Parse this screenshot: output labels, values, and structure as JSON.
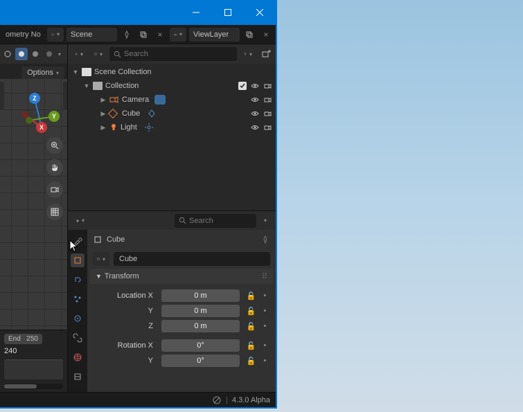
{
  "window": {
    "minimize": "minimize",
    "maximize": "maximize",
    "close": "close"
  },
  "topbar": {
    "workspace_label": "ometry No",
    "scene_name": "Scene",
    "viewlayer_name": "ViewLayer"
  },
  "viewport": {
    "options_label": "Options",
    "axis_x": "X",
    "axis_y": "Y",
    "axis_z": "Z"
  },
  "timeline": {
    "end_label": "End",
    "end_value": "250",
    "frame": "240"
  },
  "outliner": {
    "search_placeholder": "Search",
    "root": "Scene Collection",
    "collection": "Collection",
    "items": [
      {
        "name": "Camera"
      },
      {
        "name": "Cube"
      },
      {
        "name": "Light"
      }
    ]
  },
  "properties": {
    "search_placeholder": "Search",
    "breadcrumb": "Cube",
    "object_name": "Cube",
    "transform_panel": "Transform",
    "location_x_label": "Location X",
    "location_y_label": "Y",
    "location_z_label": "Z",
    "rotation_x_label": "Rotation X",
    "rotation_y_label": "Y",
    "location_x": "0 m",
    "location_y": "0 m",
    "location_z": "0 m",
    "rotation_x": "0°",
    "rotation_y": "0°"
  },
  "statusbar": {
    "version": "4.3.0 Alpha"
  }
}
